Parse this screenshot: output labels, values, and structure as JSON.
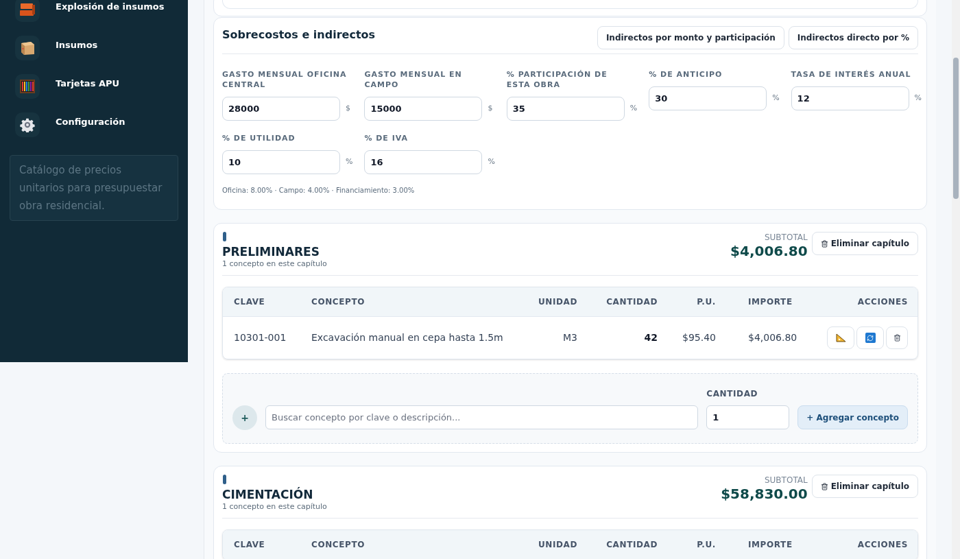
{
  "sidebar": {
    "items": [
      {
        "label": "Explosión de insumos",
        "kind": "bricks"
      },
      {
        "label": "Insumos",
        "kind": "box"
      },
      {
        "label": "Tarjetas APU",
        "kind": "abacus"
      },
      {
        "label": "Configuración",
        "kind": "gear"
      }
    ],
    "note": "Catálogo de precios unitarios para presupuestar obra residencial."
  },
  "overheads": {
    "title": "Sobrecostos e indirectos",
    "modes": [
      {
        "label": "Indirectos por monto y participación"
      },
      {
        "label": "Indirectos directo por %"
      }
    ],
    "fields": [
      {
        "label": "GASTO MENSUAL OFICINA CENTRAL",
        "value": "28000",
        "unit": "$"
      },
      {
        "label": "GASTO MENSUAL EN CAMPO",
        "value": "15000",
        "unit": "$"
      },
      {
        "label": "% PARTICIPACIÓN DE ESTA OBRA",
        "value": "35",
        "unit": "%"
      },
      {
        "label": "% DE ANTICIPO",
        "value": "30",
        "unit": "%"
      },
      {
        "label": "TASA DE INTERÉS ANUAL",
        "value": "12",
        "unit": "%"
      },
      {
        "label": "% DE UTILIDAD",
        "value": "10",
        "unit": "%"
      },
      {
        "label": "% DE IVA",
        "value": "16",
        "unit": "%"
      }
    ],
    "summary": "Oficina: 8.00% · Campo: 4.00% · Financiamiento: 3.00%"
  },
  "chapters": [
    {
      "title": "PRELIMINARES",
      "count": "1 concepto en este capítulo",
      "subtotal_label": "SUBTOTAL",
      "subtotal": "$4,006.80",
      "delete_label": "Eliminar capítulo",
      "columns": [
        "CLAVE",
        "CONCEPTO",
        "UNIDAD",
        "CANTIDAD",
        "P.U.",
        "IMPORTE",
        "ACCIONES"
      ],
      "rows": [
        {
          "clave": "10301-001",
          "concepto": "Excavación manual en cepa hasta 1.5m",
          "unidad": "M3",
          "cantidad": "42",
          "pu": "$95.40",
          "importe": "$4,006.80"
        }
      ],
      "add": {
        "plus": "+",
        "placeholder": "Buscar concepto por clave o descripción...",
        "quantity_label": "CANTIDAD",
        "quantity": "1",
        "button": "+ Agregar concepto"
      }
    },
    {
      "title": "CIMENTACIÓN",
      "count": "1 concepto en este capítulo",
      "subtotal_label": "SUBTOTAL",
      "subtotal": "$58,830.00",
      "delete_label": "Eliminar capítulo",
      "columns": [
        "CLAVE",
        "CONCEPTO",
        "UNIDAD",
        "CANTIDAD",
        "P.U.",
        "IMPORTE",
        "ACCIONES"
      ]
    }
  ]
}
